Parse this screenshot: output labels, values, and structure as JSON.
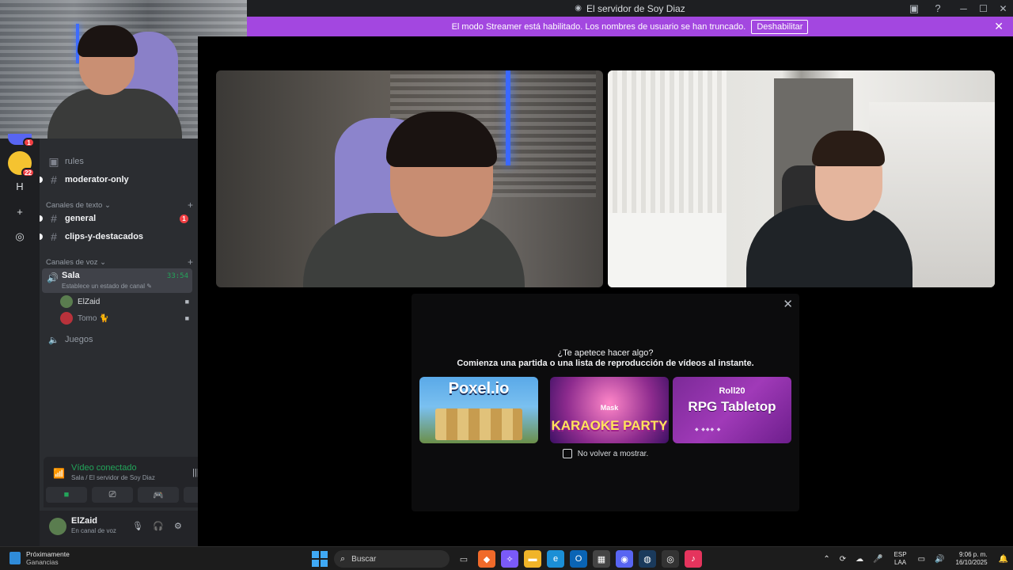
{
  "window": {
    "title": "El servidor de Soy Diaz",
    "inbox_icon": "inbox-icon",
    "help_icon": "help-icon"
  },
  "banner": {
    "text": "El modo Streamer está habilitado. Los nombres de usuario se han truncado.",
    "button_label": "Deshabilitar"
  },
  "rail": {
    "items": [
      {
        "badge": "1"
      },
      {
        "badge": "22"
      },
      {
        "label": "H"
      },
      {
        "label": "+"
      },
      {
        "label": "◎"
      }
    ]
  },
  "sidebar": {
    "channels_top": [
      {
        "name": "rules",
        "dim": true
      },
      {
        "name": "moderator-only",
        "dim": false
      }
    ],
    "text_category": "Canales de texto",
    "text_channels": [
      {
        "name": "general",
        "badge": "1"
      },
      {
        "name": "clips-y-destacados",
        "badge": ""
      }
    ],
    "voice_category": "Canales de voz",
    "voice_channels": [
      {
        "name": "Sala",
        "timer": "33:54",
        "status": "Establece un estado de canal",
        "users": [
          {
            "name": "ElZaid"
          },
          {
            "name": "Tomo 🐈"
          }
        ]
      },
      {
        "name": "Juegos"
      }
    ]
  },
  "voice_panel": {
    "status": "Vídeo conectado",
    "location": "Sala / El servidor de Soy Diaz"
  },
  "user": {
    "name": "ElZaid",
    "status": "En canal de voz"
  },
  "activity_modal": {
    "question": "¿Te apetece hacer algo?",
    "subtitle": "Comienza una partida o una lista de reproducción de vídeos al instante.",
    "cards": [
      {
        "title": "Poxel.io"
      },
      {
        "title": "KARAOKE PARTY",
        "subtitle": "Mask"
      },
      {
        "brand": "Roll20",
        "title": "RPG Tabletop"
      }
    ],
    "checkbox_label": "No volver a mostrar."
  },
  "taskbar": {
    "weather_title": "Próximamente",
    "weather_sub": "Ganancias",
    "search_placeholder": "Buscar",
    "lang_1": "ESP",
    "lang_2": "LAA",
    "time": "9:06 p. m.",
    "date": "16/10/2025"
  },
  "colors": {
    "banner": "#a347e0",
    "online_green": "#23a55a",
    "badge_red": "#f23f43"
  }
}
